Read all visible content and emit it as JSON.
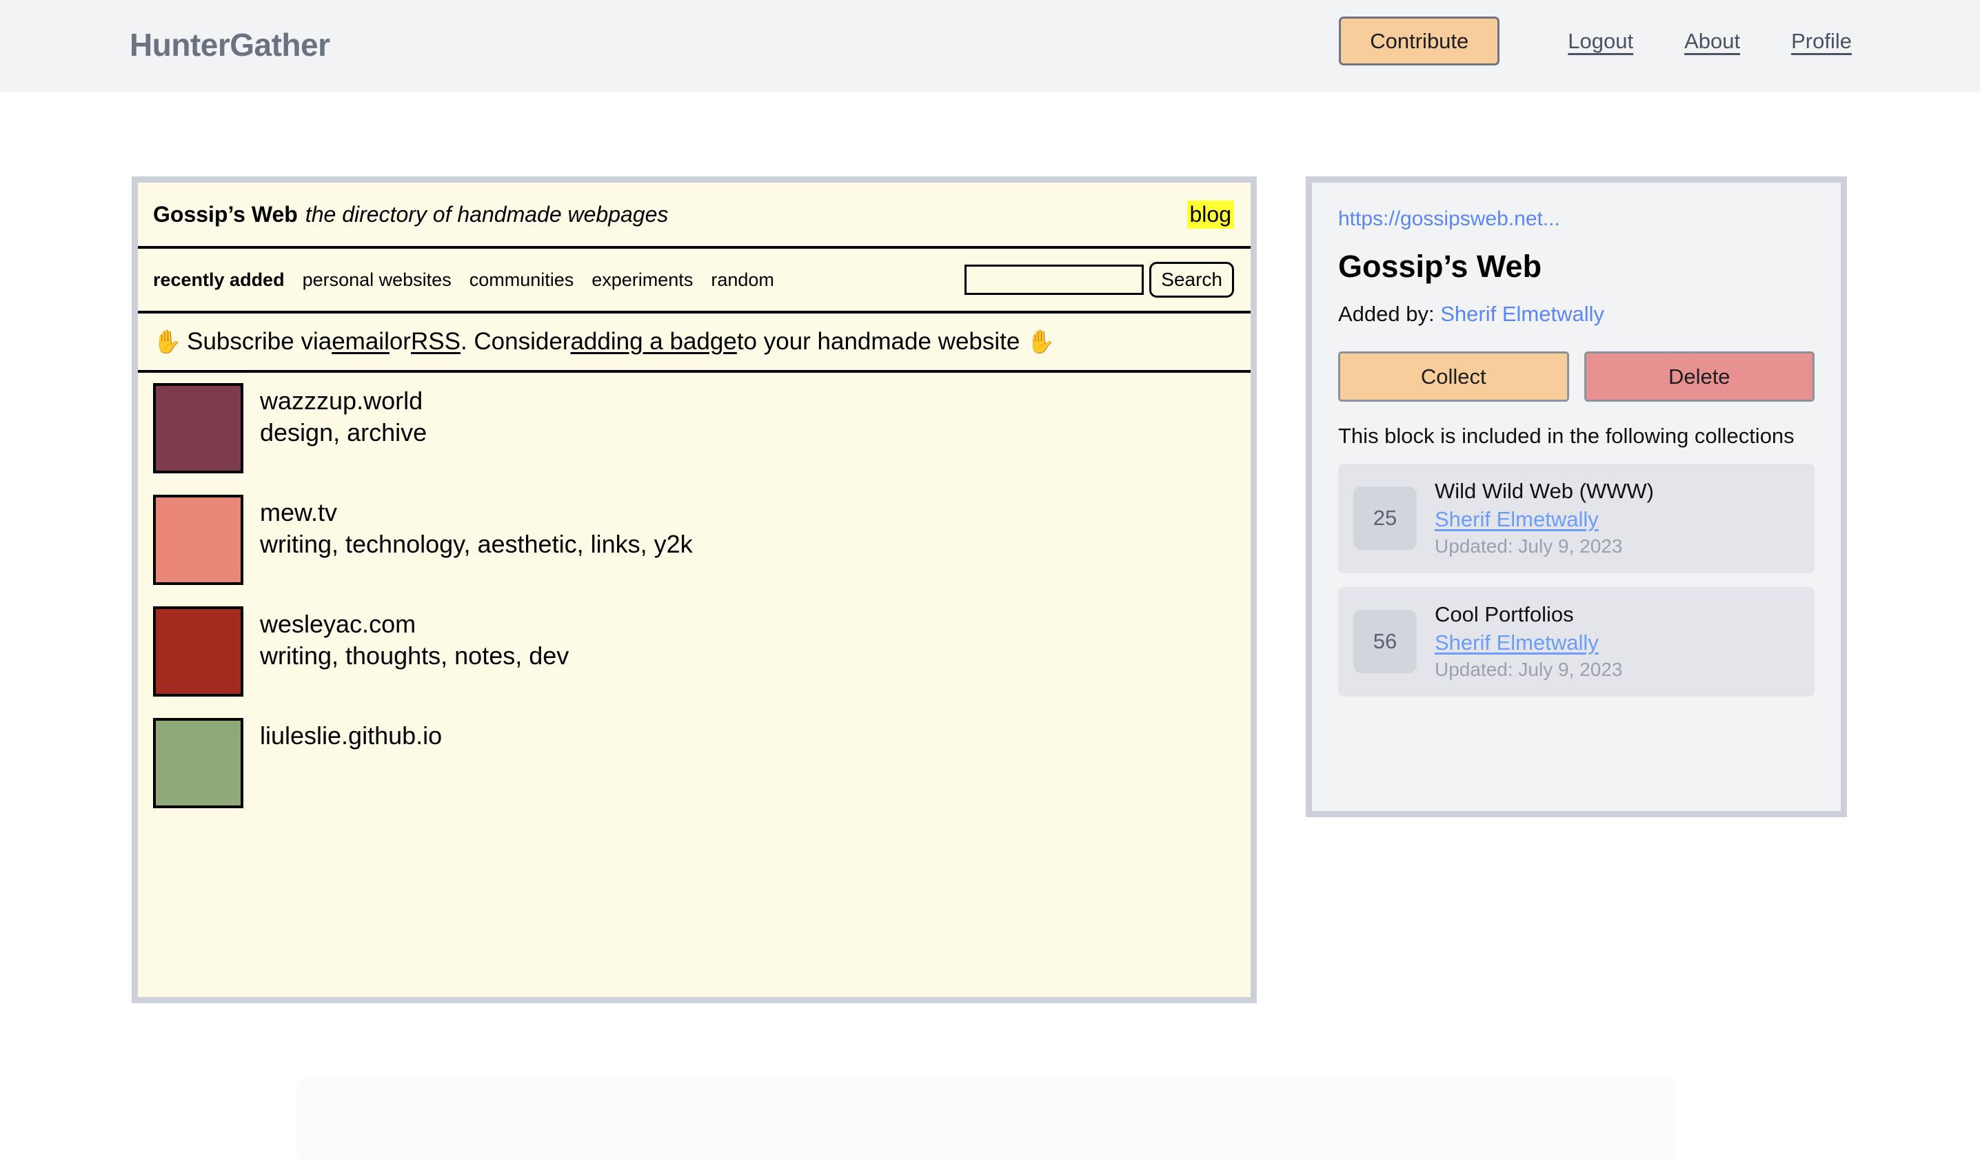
{
  "appbar": {
    "logo": "HunterGather",
    "contribute_label": "Contribute",
    "links": [
      {
        "label": "Logout"
      },
      {
        "label": "About"
      },
      {
        "label": "Profile"
      }
    ],
    "contribute_color": "#f6cd9b"
  },
  "site_card": {
    "header": {
      "title": "Gossip’s Web",
      "tagline": "the directory of handmade webpages",
      "blog_label": "blog",
      "blog_highlight_color": "#ffff33"
    },
    "nav": {
      "items": [
        {
          "label": "recently added",
          "active": true
        },
        {
          "label": "personal websites",
          "active": false
        },
        {
          "label": "communities",
          "active": false
        },
        {
          "label": "experiments",
          "active": false
        },
        {
          "label": "random",
          "active": false
        }
      ],
      "search_value": "",
      "search_placeholder": "",
      "search_button_label": "Search"
    },
    "subscribe": {
      "hand_left": "✋",
      "hand_right": "✋",
      "text_1": "Subscribe via ",
      "link_email": "email",
      "text_2": " or ",
      "link_rss": "RSS",
      "text_3": ". Consider ",
      "link_badge": "adding a badge",
      "text_4": " to your handmade website "
    },
    "listings": [
      {
        "name": "wazzzup.world",
        "tags": "design, archive",
        "thumb_color": "#7d3b4e"
      },
      {
        "name": "mew.tv",
        "tags": "writing, technology, aesthetic, links, y2k",
        "thumb_color": "#e98878"
      },
      {
        "name": "wesleyac.com",
        "tags": "writing, thoughts, notes, dev",
        "thumb_color": "#a32a1e"
      },
      {
        "name": "liuleslie.github.io",
        "tags": "",
        "thumb_color": "#8faa78"
      }
    ]
  },
  "detail_panel": {
    "url": "https://gossipsweb.net...",
    "title": "Gossip’s Web",
    "added_by_label": "Added by:",
    "added_by_name": "Sherif Elmetwally",
    "collect_label": "Collect",
    "delete_label": "Delete",
    "collect_color": "#f6cd9b",
    "delete_color": "#e89191",
    "collections_label": "This block is included in the following collections",
    "collections": [
      {
        "count": "25",
        "title": "Wild Wild Web (WWW)",
        "author": "Sherif Elmetwally",
        "updated": "Updated: July 9, 2023"
      },
      {
        "count": "56",
        "title": "Cool Portfolios",
        "author": "Sherif Elmetwally",
        "updated": "Updated: July 9, 2023"
      }
    ]
  }
}
